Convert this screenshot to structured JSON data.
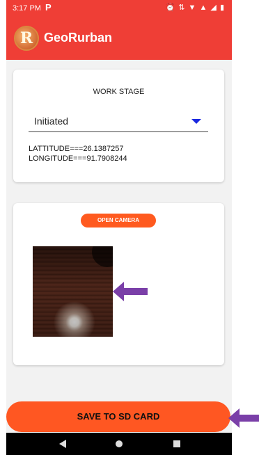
{
  "status_bar": {
    "time": "3:17 PM",
    "notification_icon": "P",
    "system_icons": "⏰ ⇅ ▼ ▲ ◢ ▮"
  },
  "app_bar": {
    "logo_letter": "R",
    "title": "GeoRurban"
  },
  "work_stage": {
    "title": "WORK STAGE",
    "selected_value": "Initiated",
    "latitude_text": "LATTITUDE===26.1387257",
    "longitude_text": "LONGITUDE===91.7908244"
  },
  "camera": {
    "open_camera_label": "OPEN CAMERA",
    "close_symbol": "×"
  },
  "save_button_label": "SAVE TO SD CARD",
  "colors": {
    "app_bar": "#ef3e36",
    "accent_button": "#ff5722",
    "dropdown_arrow": "#1a28e0",
    "annotation_arrow": "#7a3fa8"
  },
  "icons": [
    "alarm-icon",
    "wifi-icon",
    "signal-icon",
    "battery-icon",
    "close-icon",
    "back-icon",
    "home-icon",
    "recents-icon",
    "dropdown-arrow-icon"
  ]
}
